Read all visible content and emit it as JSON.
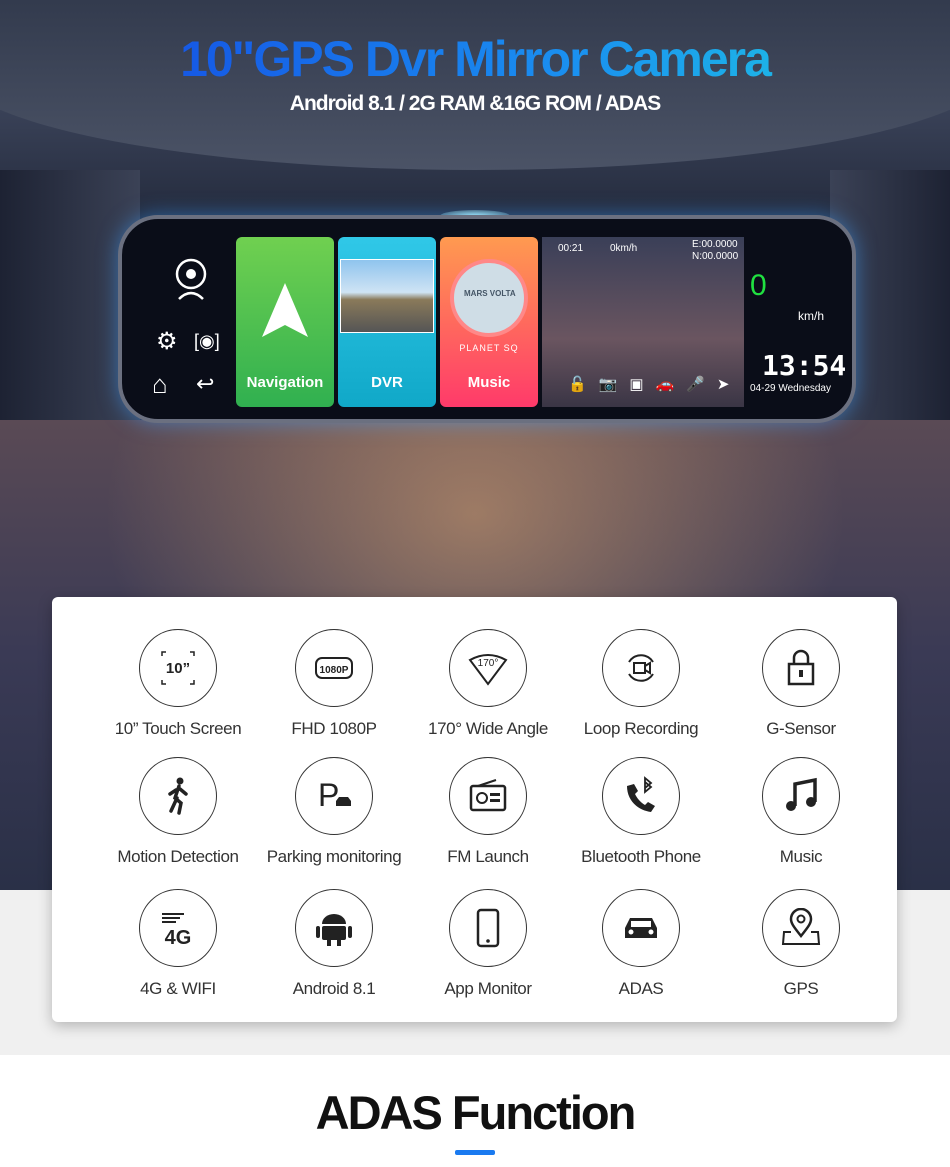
{
  "header": {
    "title": "10\"GPS Dvr Mirror Camera",
    "subtitle": "Android 8.1 / 2G RAM &16G ROM / ADAS"
  },
  "mirror": {
    "apps": [
      {
        "label": "Navigation",
        "icon": "navigation-arrow-icon"
      },
      {
        "label": "DVR",
        "icon": "road-photo-icon"
      },
      {
        "label": "Music",
        "icon": "album-disc-icon",
        "album_text": "MARS VOLTA",
        "brand": "PLANET SQ"
      }
    ],
    "camera": {
      "rec_time": "00:21",
      "speed_readout": "0km/h",
      "lon": "E:00.0000",
      "lat": "N:00.0000"
    },
    "speed": "0",
    "speed_unit": "km/h",
    "time": "13:54",
    "date": "04-29 Wednesday"
  },
  "features": [
    {
      "label": "10” Touch Screen",
      "icon": "screen-size-icon",
      "icon_text": "10”"
    },
    {
      "label": "FHD 1080P",
      "icon": "1080p-icon",
      "icon_text": "1080P"
    },
    {
      "label": "170° Wide Angle",
      "icon": "wide-angle-icon",
      "icon_text": "170°"
    },
    {
      "label": "Loop Recording",
      "icon": "loop-recording-icon"
    },
    {
      "label": "G-Sensor",
      "icon": "lock-icon"
    },
    {
      "label": "Motion Detection",
      "icon": "running-man-icon"
    },
    {
      "label": "Parking monitoring",
      "icon": "parking-icon"
    },
    {
      "label": "FM Launch",
      "icon": "radio-icon"
    },
    {
      "label": "Bluetooth Phone",
      "icon": "bluetooth-phone-icon"
    },
    {
      "label": "Music",
      "icon": "music-note-icon"
    },
    {
      "label": "4G & WIFI",
      "icon": "4g-icon",
      "icon_text": "4G"
    },
    {
      "label": "Android 8.1",
      "icon": "android-icon"
    },
    {
      "label": "App Monitor",
      "icon": "smartphone-icon"
    },
    {
      "label": "ADAS",
      "icon": "car-icon"
    },
    {
      "label": "GPS",
      "icon": "map-pin-icon"
    }
  ],
  "section": {
    "title": "ADAS Function",
    "accent": "#1a7af0"
  }
}
